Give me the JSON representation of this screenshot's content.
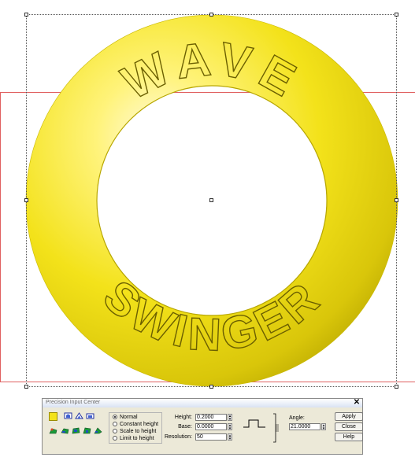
{
  "canvas": {
    "text_top": "WAVE",
    "text_bottom": "SWINGER",
    "ring_color": "#f3e21a",
    "ring_shade": "#b7a600",
    "frame_color": "#e06060"
  },
  "dialog": {
    "title": "Precision Input Center",
    "close_label": "✕",
    "modes": [
      {
        "label": "Normal",
        "selected": true
      },
      {
        "label": "Constant height",
        "selected": false
      },
      {
        "label": "Scale to height",
        "selected": false
      },
      {
        "label": "Limit to height",
        "selected": false
      }
    ],
    "height_label": "Height:",
    "height_value": "0.2000",
    "base_label": "Base:",
    "base_value": "0.0000",
    "resolution_label": "Resolution:",
    "resolution_value": "50",
    "angle_label": "Angle:",
    "angle_value": "21.0000",
    "apply_label": "Apply",
    "close_button_label": "Close",
    "help_label": "Help"
  }
}
